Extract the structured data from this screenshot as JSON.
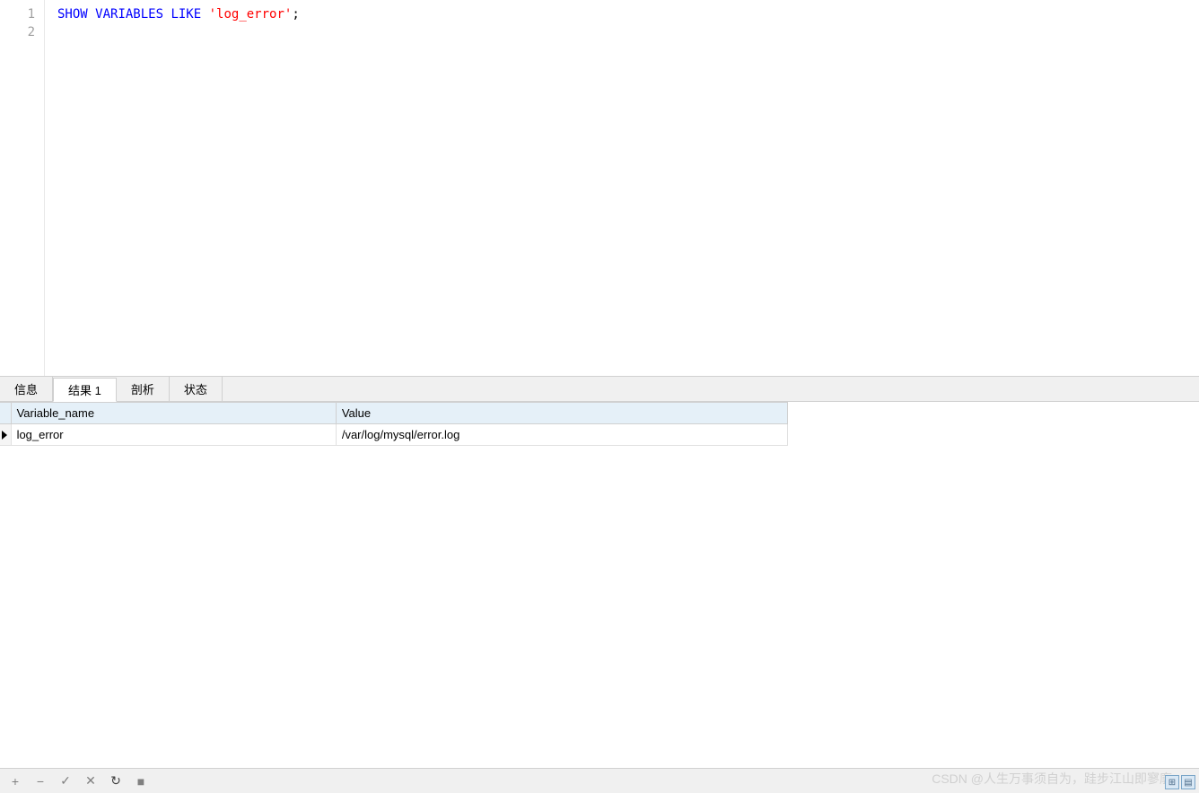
{
  "editor": {
    "lines": [
      "1",
      "2"
    ],
    "code_tokens": {
      "show": "SHOW",
      "variables": "VARIABLES",
      "like": "LIKE",
      "string": "'log_error'",
      "semi": ";"
    }
  },
  "tabs": [
    {
      "label": "信息",
      "active": false
    },
    {
      "label": "结果 1",
      "active": true
    },
    {
      "label": "剖析",
      "active": false
    },
    {
      "label": "状态",
      "active": false
    }
  ],
  "table": {
    "headers": [
      "Variable_name",
      "Value"
    ],
    "rows": [
      {
        "variable_name": "log_error",
        "value": "/var/log/mysql/error.log"
      }
    ]
  },
  "toolbar": {
    "plus": "+",
    "minus": "−",
    "check": "✓",
    "close": "✕",
    "refresh": "↻",
    "stop": "■"
  },
  "watermark": "CSDN @人生万事须自为，跬步江山即寥廓"
}
